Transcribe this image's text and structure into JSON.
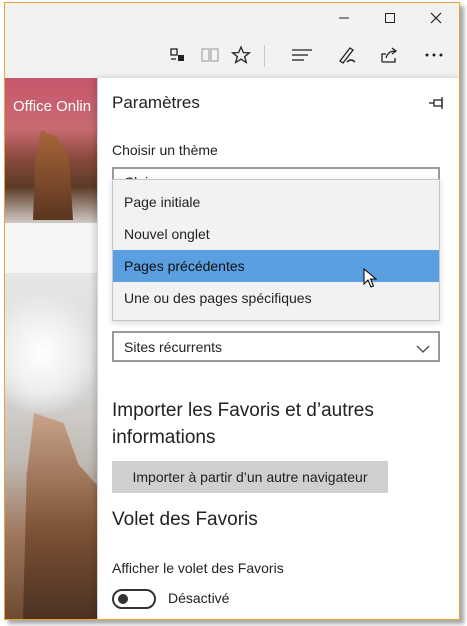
{
  "window": {
    "minimize_icon": "minimize-icon",
    "maximize_icon": "maximize-icon",
    "close_icon": "close-icon",
    "frame_color": "#e8a33a"
  },
  "toolbar": {
    "icons": [
      "translate-icon",
      "reading-view-icon",
      "favorites-star-icon",
      "hub-icon",
      "web-note-icon",
      "share-icon",
      "more-icon"
    ]
  },
  "background_page": {
    "tile_text": "Office Onlin"
  },
  "settings": {
    "title": "Paramètres",
    "pin_icon": "pin-icon",
    "theme_label": "Choisir un thème",
    "theme_value": "Clai",
    "startup_menu": {
      "options": [
        "Page initiale",
        "Nouvel onglet",
        "Pages précédentes",
        "Une ou des pages spécifiques"
      ],
      "highlighted": "Pages précédentes",
      "highlight_color": "#5a9fe0"
    },
    "newtab_value": "Sites récurrents",
    "import_heading": "Importer les Favoris et d’autres informations",
    "import_button": "Importer à partir d’un autre navigateur",
    "favorites_bar_heading": "Volet des Favoris",
    "favorites_bar_label": "Afficher le volet des Favoris",
    "favorites_bar_state": "Désactivé"
  }
}
